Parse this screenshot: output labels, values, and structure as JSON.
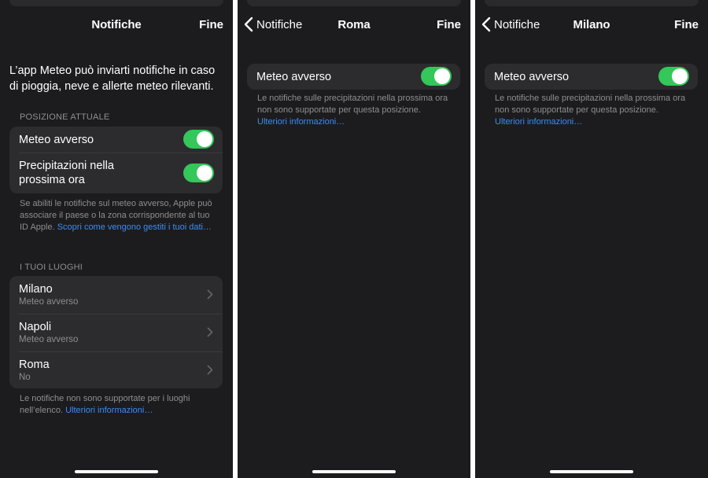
{
  "screen1": {
    "title": "Notifiche",
    "done": "Fine",
    "intro": "L’app Meteo può inviarti notifiche in caso di pioggia, neve e allerte meteo rilevanti.",
    "current_location": {
      "header": "POSIZIONE ATTUALE",
      "rows": [
        {
          "label": "Meteo avverso",
          "toggle_on": true
        },
        {
          "label": "Precipitazioni nella prossima ora",
          "toggle_on": true
        }
      ],
      "footnote": "Se abiliti le notifiche sul meteo avverso, Apple può associare il paese o la zona corrispondente al tuo ID Apple.",
      "footnote_link": "Scopri come vengono gestiti i tuoi dati…"
    },
    "places": {
      "header": "I TUOI LUOGHI",
      "items": [
        {
          "name": "Milano",
          "status": "Meteo avverso"
        },
        {
          "name": "Napoli",
          "status": "Meteo avverso"
        },
        {
          "name": "Roma",
          "status": "No"
        }
      ],
      "footnote": "Le notifiche non sono supportate per i luoghi nell’elenco.",
      "footnote_link": "Ulteriori informazioni…"
    }
  },
  "screen2": {
    "back": "Notifiche",
    "title": "Roma",
    "done": "Fine",
    "row_label": "Meteo avverso",
    "toggle_on": true,
    "footnote": "Le notifiche sulle precipitazioni nella prossima ora non sono supportate per questa posizione.",
    "footnote_link": "Ulteriori informazioni…"
  },
  "screen3": {
    "back": "Notifiche",
    "title": "Milano",
    "done": "Fine",
    "row_label": "Meteo avverso",
    "toggle_on": true,
    "footnote": "Le notifiche sulle precipitazioni nella prossima ora non sono supportate per questa posizione.",
    "footnote_link": "Ulteriori informazioni…"
  },
  "colors": {
    "background": "#1c1c1e",
    "cell": "#2c2c2e",
    "toggle_on": "#34c759",
    "link": "#3b8cf5",
    "secondary_text": "#8e8e93"
  },
  "icons": [
    "chevron-left-icon",
    "chevron-right-icon"
  ]
}
